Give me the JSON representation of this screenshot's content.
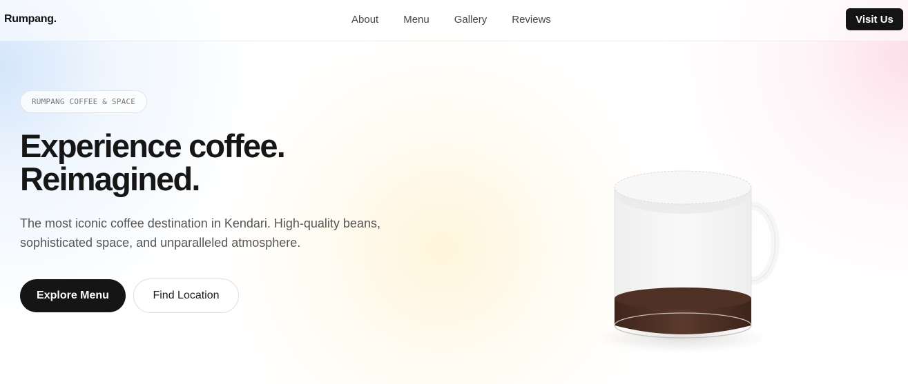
{
  "nav": {
    "brand": "Rumpang.",
    "links": [
      {
        "label": "About"
      },
      {
        "label": "Menu"
      },
      {
        "label": "Gallery"
      },
      {
        "label": "Reviews"
      }
    ],
    "cta_label": "Visit Us"
  },
  "hero": {
    "tag": "RUMPANG COFFEE & SPACE",
    "headline_line1": "Experience coffee.",
    "headline_line2": "Reimagined.",
    "subtitle": "The most iconic coffee destination in Kendari. High-quality beans, sophisticated space, and unparalleled atmosphere.",
    "primary_button": "Explore Menu",
    "secondary_button": "Find Location"
  },
  "illustration": {
    "icon": "coffee-cup-illustration",
    "colors": {
      "coffee": "#4a2e22",
      "glass": "#f4f4f4"
    }
  },
  "colors": {
    "accent": "#141414",
    "text_muted": "#555555"
  }
}
